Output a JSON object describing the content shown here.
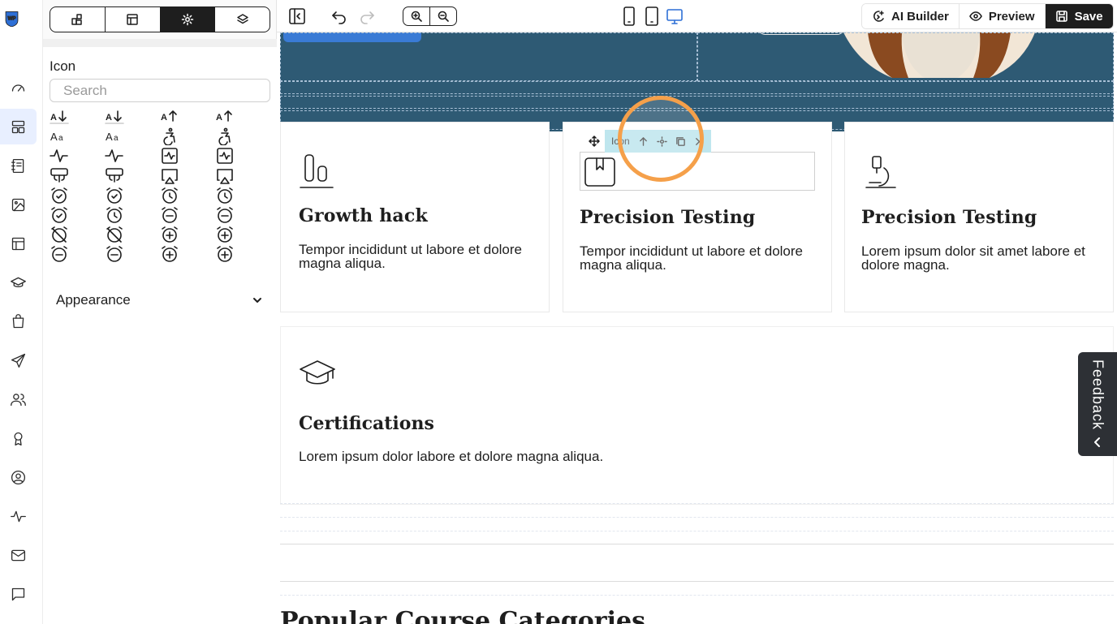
{
  "panel": {
    "tabs": [
      {
        "name": "elements",
        "icon": "widgets-icon"
      },
      {
        "name": "layout",
        "icon": "layout-icon"
      },
      {
        "name": "settings",
        "icon": "gear-icon",
        "active": true
      },
      {
        "name": "layers",
        "icon": "layers-icon"
      }
    ],
    "icon_label": "Icon",
    "search_placeholder": "Search",
    "icon_names": [
      "sort-alpha-down-icon",
      "sort-alpha-down-icon",
      "sort-alpha-up-icon",
      "sort-alpha-up-icon",
      "text-size-icon",
      "text-size-icon",
      "accessible-icon",
      "accessible-icon",
      "activity-icon",
      "activity-icon",
      "activity-square-icon",
      "activity-square-icon",
      "air-conditioning-icon",
      "air-conditioning-icon",
      "airplay-icon",
      "airplay-icon",
      "alarm-check-icon",
      "alarm-check-icon",
      "alarm-clock-icon",
      "alarm-clock-icon",
      "alarm-check-icon",
      "alarm-clock-icon",
      "alarm-minus-icon",
      "alarm-minus-icon",
      "alarm-off-icon",
      "alarm-off-icon",
      "alarm-plus-icon",
      "alarm-plus-icon",
      "alarm-minus-icon",
      "alarm-minus-icon",
      "alarm-plus-icon",
      "alarm-plus-icon"
    ],
    "appearance_label": "Appearance"
  },
  "toolbar": {
    "ai_builder": "AI Builder",
    "preview": "Preview",
    "save": "Save"
  },
  "canvas": {
    "selection_label": "Icon",
    "cards": [
      {
        "icon": "growth-bars-icon",
        "title": "Growth hack",
        "text": "Tempor incididunt ut labore et dolore magna aliqua."
      },
      {
        "icon": "bookmark-icon",
        "title": "Precision Testing",
        "text": "Tempor incididunt ut labore et dolore magna aliqua."
      },
      {
        "icon": "microscope-icon",
        "title": "Precision Testing",
        "text": "Lorem ipsum dolor sit amet  labore et dolore magna."
      }
    ],
    "certifications": {
      "icon": "graduation-cap-icon",
      "title": "Certifications",
      "text": "Lorem ipsum dolor  labore et dolore magna aliqua."
    },
    "bottom_title": "Popular Course Categories"
  },
  "feedback": "Feedback",
  "colors": {
    "hero_bg": "#2e5a74",
    "accent": "#3a7bd5",
    "highlight_ring": "#f5a04a",
    "selection_chip": "#bfe6ee",
    "active_rail": "#e8efff"
  }
}
